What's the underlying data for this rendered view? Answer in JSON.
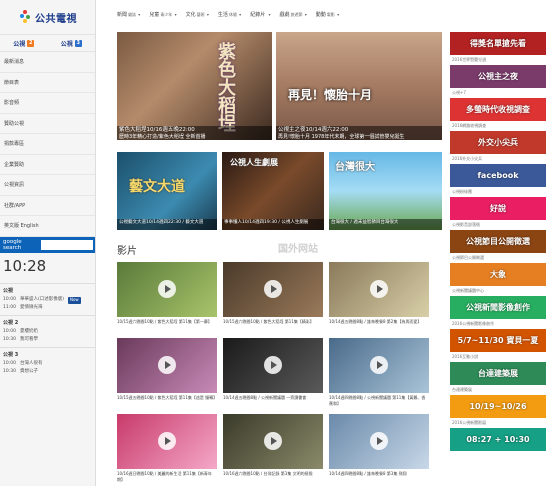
{
  "brand": {
    "name": "公共電視"
  },
  "channels": [
    {
      "label": "公視",
      "num": "2"
    },
    {
      "label": "公視",
      "num": "3"
    }
  ],
  "side_menu": [
    "最新消息",
    "節目表",
    "影音頻",
    "贊助公視",
    "捐款專區",
    "企業贊助",
    "公視資訊",
    "社群/APP",
    "英文版 English"
  ],
  "search": {
    "label": "google search",
    "placeholder": ""
  },
  "clock": "10:28",
  "schedule": [
    {
      "title": "公視",
      "rows": [
        {
          "time": "10:00",
          "prog": "華華盛人(口述影像版)",
          "now": "Now"
        },
        {
          "time": "11:00",
          "prog": "愛情微光海",
          "now": ""
        }
      ]
    },
    {
      "title": "公視 2",
      "rows": [
        {
          "time": "10:00",
          "prog": "夏樓奶奶",
          "now": ""
        },
        {
          "time": "10:30",
          "prog": "我可看學",
          "now": ""
        }
      ]
    },
    {
      "title": "公視 3",
      "rows": [
        {
          "time": "10:00",
          "prog": "台灣人很有",
          "now": ""
        },
        {
          "time": "10:30",
          "prog": "資想公子",
          "now": ""
        }
      ]
    }
  ],
  "topnav": [
    {
      "label": "新聞",
      "sub": "雜誌"
    },
    {
      "label": "兒童",
      "sub": "青少年"
    },
    {
      "label": "文化",
      "sub": "藝術"
    },
    {
      "label": "生活",
      "sub": "休閒"
    },
    {
      "label": "紀錄片",
      "sub": ""
    },
    {
      "label": "戲劇",
      "sub": "旅遊節"
    },
    {
      "label": "動動",
      "sub": "電影"
    }
  ],
  "heroes": [
    {
      "title": "紫色大稻埕10/16週五晚22:00",
      "sub": "歷時3年精心打造/紫色大稻埕 全新首播",
      "big": "紫色大稻埕"
    },
    {
      "title": "公視主之夜10/14週六22:00",
      "sub": "再見!懷胎十月 1978年代末期，全球第一個試管嬰兒誕生",
      "big": "再見！懷胎十月"
    }
  ],
  "promos": [
    {
      "cap": "公視藝文大道10/14週四22:30 / 藝文大道",
      "big": "藝文大道"
    },
    {
      "cap": "事事懂人10/14週四19:30 / 公視人生劇展",
      "big": "公視人生劇展"
    },
    {
      "cap": "台灣很大 / 週末益智節目台灣很大",
      "big": "台灣很大"
    }
  ],
  "section_title": "影片",
  "videos": [
    "10/15週六晚間10點 / 紫色大稻埕 第11集【第一幕】",
    "10/15週六晚間10點 / 紫色大稻埕 第11集【精彩】",
    "10/14週五晚間8點 / 誰來晚餐8 第2集【為男而愛】",
    "10/15週五晚間10點 / 紫色大稻埕 第11集【這是 慢轉】",
    "10/14週五晚間8點 / 公視新聞議題 一旁讀書會",
    "10/14週四晚間8點 / 公視新聞議題 第11集【黃鵝、香蕉和】",
    "10/16週日晚間10點 / 美麗的新生活 第11集【新青年期】",
    "10/16週六晚間10點 / 台灣記錄 第3集 文明的極限",
    "10/14週四晚間8點 / 誰來晚餐8 第3集 飛翔"
  ],
  "right_ads": [
    {
      "t": "得獎名單搶先看",
      "cap": "2016世界暨嬰兒週",
      "c": "#b22222"
    },
    {
      "t": "公視主之夜",
      "cap": "公視+7",
      "c": "#7a3a6a"
    },
    {
      "t": "多螢時代收視調查",
      "cap": "2016網路收視調查",
      "c": "#d33"
    },
    {
      "t": "外交小尖兵",
      "cap": "2016外交小尖兵",
      "c": "#c0392b"
    },
    {
      "t": "facebook",
      "cap": "公視粉絲團",
      "c": "#3b5998"
    },
    {
      "t": "好說",
      "cap": "公視影音部落格",
      "c": "#e91e63"
    },
    {
      "t": "公視節目公開徵選",
      "cap": "公視節目公開徵選",
      "c": "#8b4513"
    },
    {
      "t": "大象",
      "cap": "公視新聞議題中心",
      "c": "#e67e22"
    },
    {
      "t": "公視新聞影像創作",
      "cap": "2016公視新聞影像創作",
      "c": "#27ae60"
    },
    {
      "t": "5/7~11/30 寶貝一夏",
      "cap": "2016互動小說",
      "c": "#d35400"
    },
    {
      "t": "台達建築展",
      "cap": "台達建築展",
      "c": "#2e8b57"
    },
    {
      "t": "10/19~10/26",
      "cap": "2016公視新聞影展",
      "c": "#f39c12"
    },
    {
      "t": "08:27 + 10:30",
      "cap": "",
      "c": "#16a085"
    }
  ],
  "watermark": "国外网站"
}
